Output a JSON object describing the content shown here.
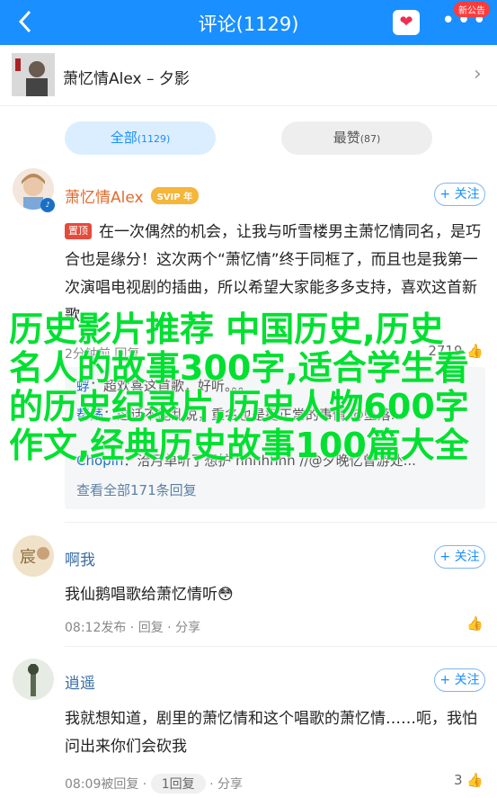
{
  "header": {
    "title": "评论(1129)",
    "new_badge": "新公告",
    "back_icon": "chevron-left-icon",
    "heart_icon": "heart-icon",
    "more_icon": "more-icon"
  },
  "song": {
    "title": "萧忆情Alex – 夕影"
  },
  "tabs": {
    "all_label": "全部",
    "all_count": "(1129)",
    "hot_label": "最赞",
    "hot_count": "(87)"
  },
  "comments": [
    {
      "user": "萧忆情Alex",
      "vip": "SVIP",
      "vip_suffix": "年",
      "follow": "+ 关注",
      "pin": "置顶",
      "text": "在一次偶然的机会，让我与听雪楼男主萧忆情同名，是巧合也是缘分！这次两个“萧忆情”终于同框了，而且也是我第一次演唱电视剧的插曲，所以希望大家能多多支持，喜欢这首新歌",
      "time": "2分钟前",
      "time_suffix": "前加 点赞",
      "reply": "回复",
      "likes": "2719",
      "replies": [
        {
          "name": "蜉",
          "text": "超欢喜这首歌，好听。。。"
        },
        {
          "name": "帮荡",
          "text": "这话不能乱说，重名也是挺正常的事情 @坠落..."
        },
        {
          "name": "Chopin",
          "text": "洽月单听了想护 hhhhhhh //@夕晚忆曾游处..."
        }
      ],
      "view_all": "查看全部171条回复"
    },
    {
      "user": "啊我",
      "follow": "+ 关注",
      "text": "我仙鹅唱歌给萧忆情听😳",
      "time": "08:12发布",
      "reply": "回复",
      "share": "分享"
    },
    {
      "user": "逍遥",
      "follow": "+ 关注",
      "text": "我就想知道，剧里的萧忆情和这个唱歌的萧忆情……呃，我怕问出来你们会砍我",
      "time": "08:09被回复",
      "reply_count": "1回复",
      "share": "分享",
      "likes": "3"
    }
  ],
  "overlay": {
    "text": "历史影片推荐 中国历史,历史名人的故事300字,适合学生看的历史纪录片,历史人物600字作文,经典历史故事100篇大全"
  },
  "colors": {
    "accent": "#1a8fff",
    "overlay": "#00e030",
    "vip": "#f5b63a",
    "pin": "#e64a3b"
  }
}
